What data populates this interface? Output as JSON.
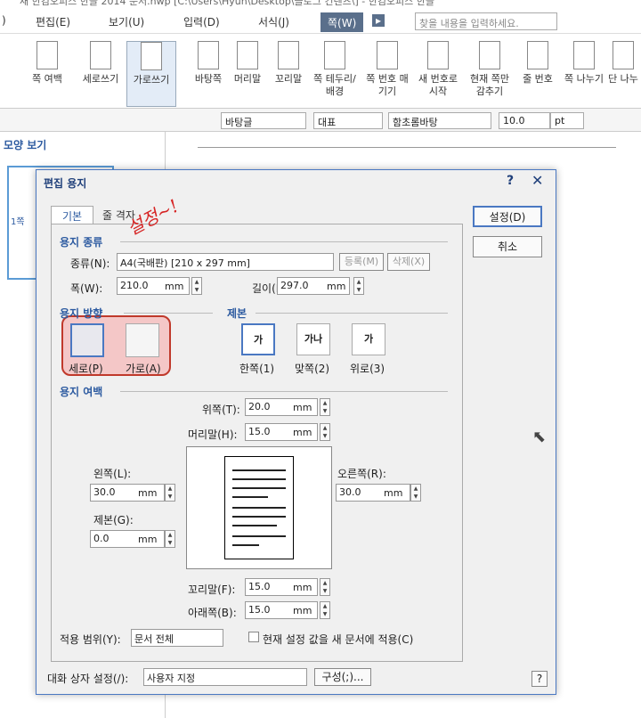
{
  "titlebar": "새 한컴오피스 한글 2014 문서.hwp [C:\\Users\\Hyun\\Desktop\\블로그 컨텐츠\\] - 한컴오피스 한글",
  "menu": {
    "m0": ")",
    "m1": "편집(E)",
    "m2": "보기(U)",
    "m3": "입력(D)",
    "m4": "서식(J)",
    "active": "쪽(W)",
    "search": "찾을 내용을 입력하세요."
  },
  "ribbon": {
    "b1": "쪽 여백",
    "b2": "세로쓰기",
    "b3": "가로쓰기",
    "b4": "바탕쪽",
    "b5": "머리말",
    "b6": "꼬리말",
    "b7": "쪽 테두리/배경",
    "b8": "쪽 번호 매기기",
    "b9": "새 번호로 시작",
    "b10": "현재 쪽만 감추기",
    "b11": "줄 번호",
    "b12": "쪽 나누기",
    "b13": "단 나누"
  },
  "toolbar": {
    "style": "바탕글",
    "lang": "대표",
    "font": "함초롬바탕",
    "size": "10.0",
    "unit": "pt"
  },
  "pane": {
    "title": "모양 보기",
    "page": "1쪽"
  },
  "dialog": {
    "title": "편집 용지",
    "help": "?",
    "close": "✕",
    "tabs": {
      "basic": "기본",
      "grid": "줄 격자"
    },
    "paper": {
      "section": "용지 종류",
      "kind_label": "종류(N):",
      "kind_value": "A4(국배판) [210 x 297 mm]",
      "register": "등록(M)",
      "delete": "삭제(X)",
      "width_label": "폭(W):",
      "width": "210.0",
      "height_label": "길이(E):",
      "height": "297.0",
      "unit": "mm"
    },
    "orientation": {
      "section": "용지 방향",
      "portrait": "세로(P)",
      "landscape": "가로(A)"
    },
    "binding": {
      "section": "제본",
      "single": "한쪽(1)",
      "facing": "맞쪽(2)",
      "top": "위로(3)"
    },
    "margins": {
      "section": "용지 여백",
      "top_label": "위쪽(T):",
      "top": "20.0",
      "header_label": "머리말(H):",
      "header": "15.0",
      "left_label": "왼쪽(L):",
      "left": "30.0",
      "right_label": "오른쪽(R):",
      "right": "30.0",
      "gutter_label": "제본(G):",
      "gutter": "0.0",
      "footer_label": "꼬리말(F):",
      "footer": "15.0",
      "bottom_label": "아래쪽(B):",
      "bottom": "15.0"
    },
    "scope": {
      "label": "적용 범위(Y):",
      "value": "문서 전체",
      "checkbox": "현재 설정 값을 새 문서에 적용(C)"
    },
    "buttons": {
      "ok": "설정(D)",
      "cancel": "취소"
    },
    "footer": {
      "label": "대화 상자 설정(/):",
      "value": "사용자 지정",
      "config": "구성(;)...",
      "help": "?"
    }
  },
  "annotation": "설정~!"
}
